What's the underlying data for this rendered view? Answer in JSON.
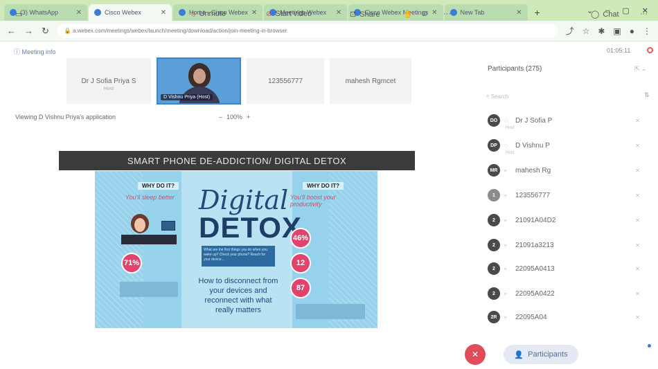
{
  "browser": {
    "tabs": [
      {
        "label": "(3) WhatsApp",
        "active": false
      },
      {
        "label": "Cisco Webex",
        "active": true
      },
      {
        "label": "Home - Cisco Webex",
        "active": false
      },
      {
        "label": "Meetings Webex",
        "active": false
      },
      {
        "label": "Cisco Webex Meetings",
        "active": false
      },
      {
        "label": "New Tab",
        "active": false
      }
    ],
    "url": "a.webex.com/meetings/webex/launch/meeting/download/action/join-meeting-in-browser"
  },
  "meeting": {
    "info_label": "Meeting info",
    "timer": "01:05:11",
    "thumbnails": [
      {
        "name": "Dr J Sofia Priya S",
        "sub": "Host"
      },
      {
        "name": "D Vishnu Priya (Host)"
      },
      {
        "name": "123556777"
      },
      {
        "name": "mahesh Rgmcet"
      }
    ],
    "viewing": "Viewing D Vishnu Priya's application",
    "zoom": "100%",
    "zoom_minus": "–",
    "zoom_plus": "+"
  },
  "slide": {
    "title": "SMART PHONE DE-ADDICTION/ DIGITAL DETOX",
    "why_left": "WHY DO IT?",
    "why_right": "WHY DO IT?",
    "hand_left": "You'll sleep better",
    "hand_right": "You'll boost your productivity",
    "digital": "Digital",
    "detox": "DETOX",
    "blue_text": "What are the first things you do when you wake up? Check your phone? Reach for your device...",
    "mid_text": "How to disconnect from your devices and reconnect with what really matters",
    "stats": [
      "71%",
      "46%",
      "12",
      "87"
    ]
  },
  "participants": {
    "title": "Participants (275)",
    "search_placeholder": "Search",
    "list": [
      {
        "initials": "DO",
        "name": "Dr J Sofia P",
        "sub": "Host"
      },
      {
        "initials": "DP",
        "name": "D Vishnu P",
        "sub": "Host"
      },
      {
        "initials": "MR",
        "name": "mahesh Rg"
      },
      {
        "initials": "1",
        "name": "123556777"
      },
      {
        "initials": "2",
        "name": "21091A04D2"
      },
      {
        "initials": "2",
        "name": "21091a3213"
      },
      {
        "initials": "2",
        "name": "22095A0413"
      },
      {
        "initials": "2",
        "name": "22095A0422"
      },
      {
        "initials": "2R",
        "name": "22095A04"
      }
    ]
  },
  "toolbar": {
    "unmute": "Unmute",
    "start_video": "Start video",
    "share": "Share",
    "participants": "Participants",
    "chat": "Chat"
  }
}
